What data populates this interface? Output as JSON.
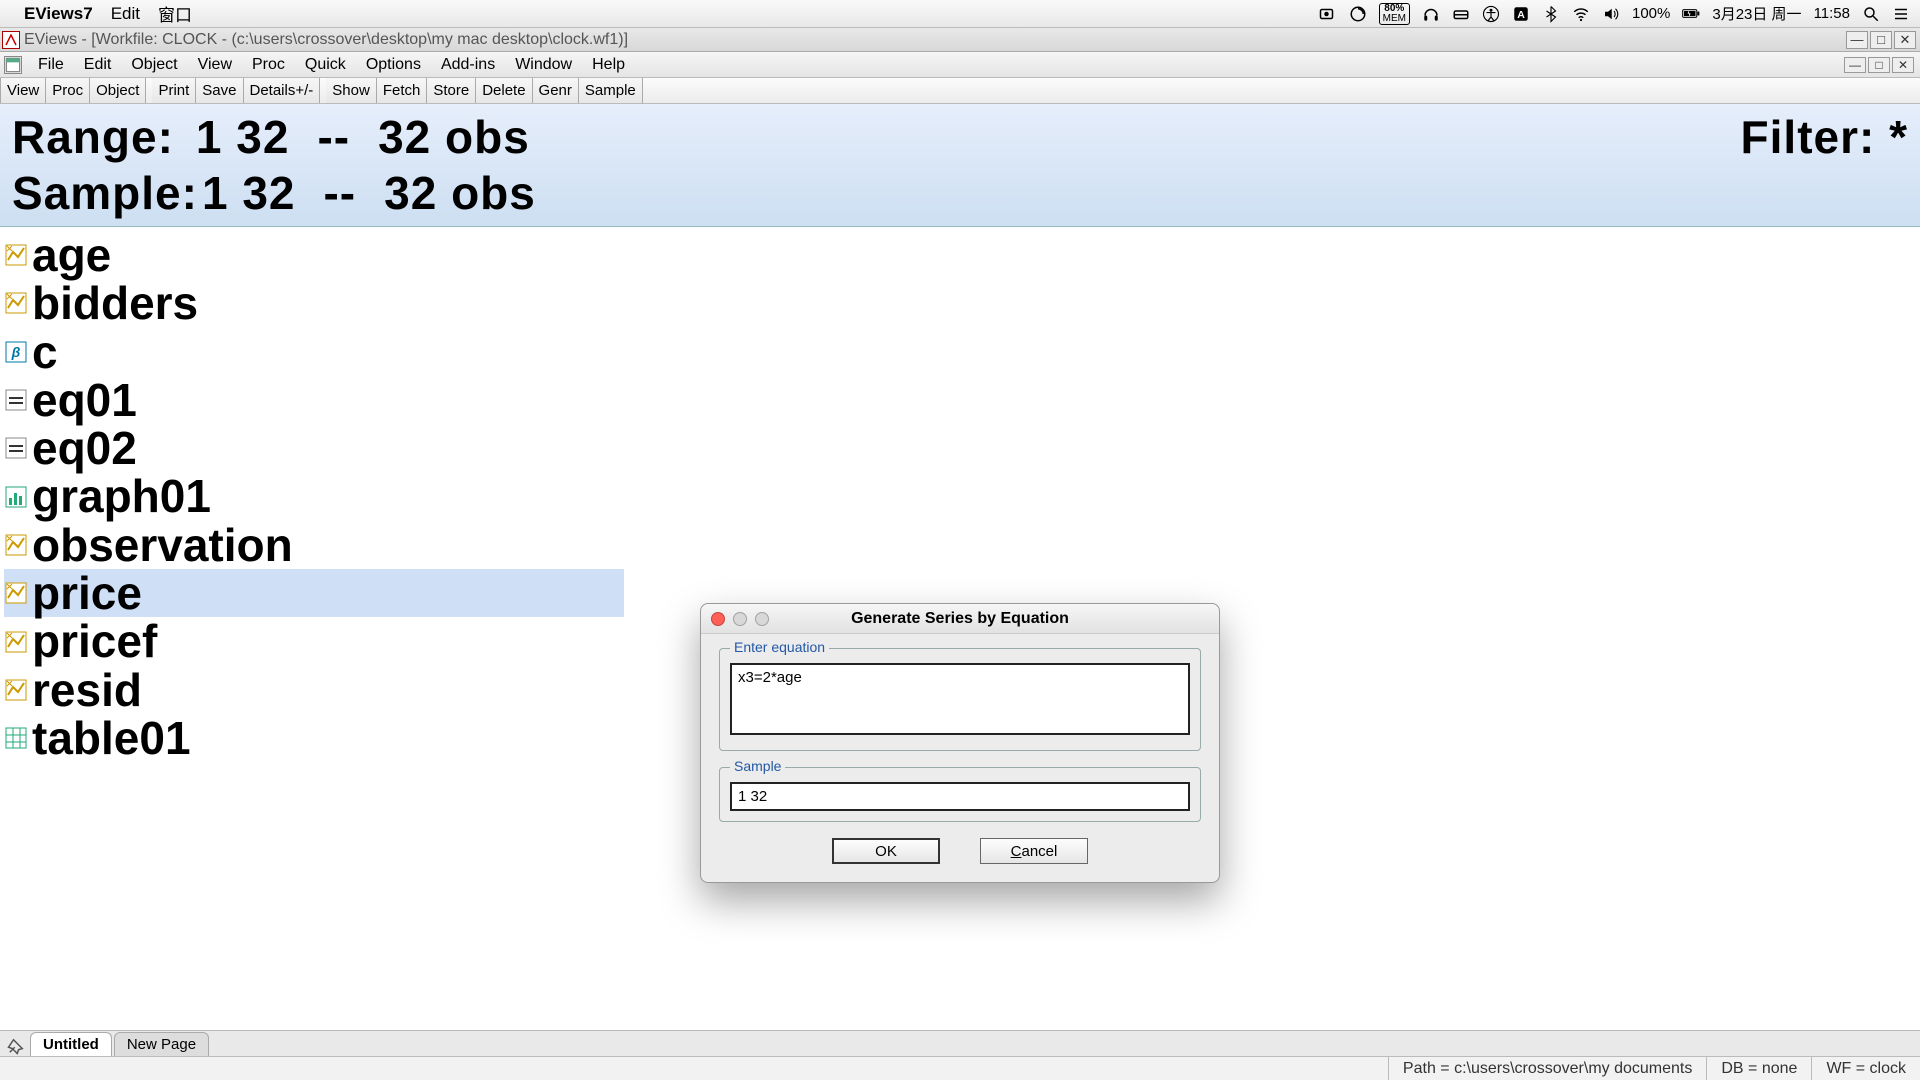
{
  "mac_menubar": {
    "app_name": "EViews7",
    "menus": [
      "Edit",
      "窗口"
    ],
    "mem_percent": "80%",
    "mem_label": "MEM",
    "battery_text": "100%",
    "date_text": "3月23日 周一",
    "time_text": "11:58"
  },
  "ev_window": {
    "title": "EViews - [Workfile: CLOCK - (c:\\users\\crossover\\desktop\\my mac desktop\\clock.wf1)]",
    "menus": [
      "File",
      "Edit",
      "Object",
      "View",
      "Proc",
      "Quick",
      "Options",
      "Add-ins",
      "Window",
      "Help"
    ],
    "toolbar_groups": [
      [
        "View",
        "Proc",
        "Object"
      ],
      [
        "Print",
        "Save",
        "Details+/-"
      ],
      [
        "Show",
        "Fetch",
        "Store",
        "Delete",
        "Genr",
        "Sample"
      ]
    ],
    "header": {
      "range_label": "Range:",
      "range_value": "1 32",
      "range_obs": "32 obs",
      "sample_label": "Sample:",
      "sample_value": "1 32",
      "sample_obs": "32 obs",
      "filter_label": "Filter: *"
    },
    "objects": [
      {
        "name": "age",
        "type": "series",
        "selected": false
      },
      {
        "name": "bidders",
        "type": "series",
        "selected": false
      },
      {
        "name": "c",
        "type": "coef",
        "selected": false
      },
      {
        "name": "eq01",
        "type": "equation",
        "selected": false
      },
      {
        "name": "eq02",
        "type": "equation",
        "selected": false
      },
      {
        "name": "graph01",
        "type": "graph",
        "selected": false
      },
      {
        "name": "observation",
        "type": "series",
        "selected": false
      },
      {
        "name": "price",
        "type": "series",
        "selected": true
      },
      {
        "name": "pricef",
        "type": "series",
        "selected": false
      },
      {
        "name": "resid",
        "type": "series",
        "selected": false
      },
      {
        "name": "table01",
        "type": "table",
        "selected": false
      }
    ],
    "tabs": {
      "active": "Untitled",
      "other": "New Page"
    },
    "status": {
      "path": "Path = c:\\users\\crossover\\my documents",
      "db": "DB = none",
      "wf": "WF = clock"
    }
  },
  "dialog": {
    "title": "Generate Series by Equation",
    "equation_legend": "Enter equation",
    "equation_value": "x3=2*age",
    "sample_legend": "Sample",
    "sample_value": "1 32",
    "ok_label": "OK",
    "cancel_label": "Cancel"
  }
}
